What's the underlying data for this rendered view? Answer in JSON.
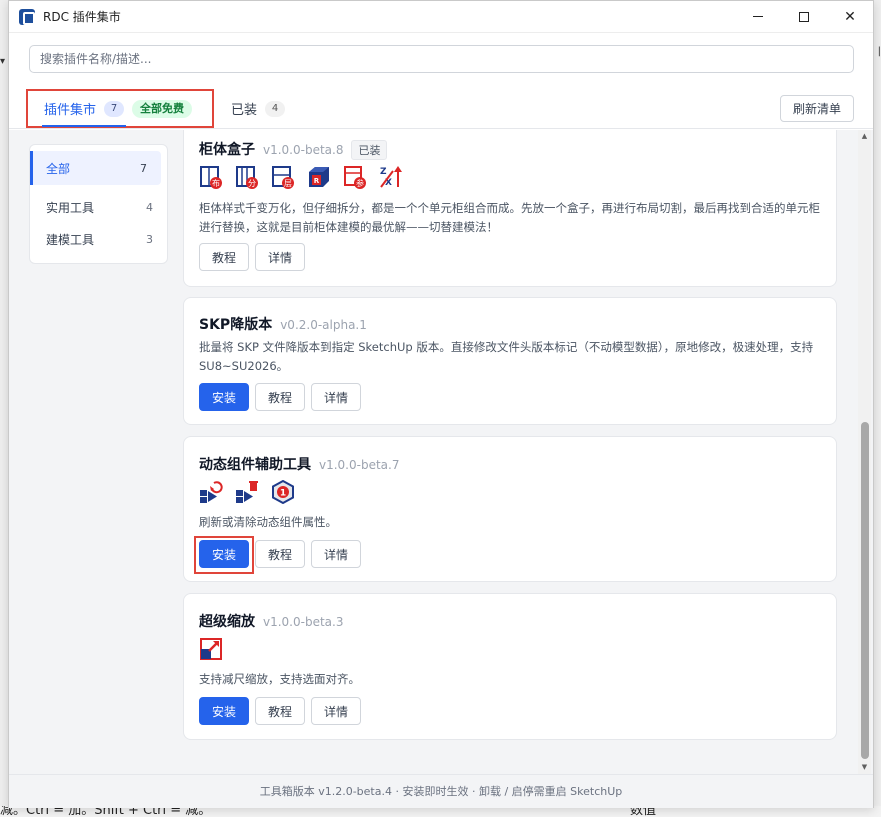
{
  "window": {
    "title": "RDC 插件集市",
    "minimize_glyph": "—",
    "maximize_glyph": "☐",
    "close_glyph": "✕"
  },
  "search": {
    "placeholder": "搜索插件名称/描述...",
    "value": ""
  },
  "tabs": [
    {
      "label": "插件集市",
      "count": "7",
      "badge": "全部免费",
      "active": true
    },
    {
      "label": "已装",
      "count": "4",
      "active": false
    }
  ],
  "refresh_label": "刷新清单",
  "sidebar": {
    "items": [
      {
        "label": "全部",
        "count": "7",
        "active": true
      },
      {
        "label": "实用工具",
        "count": "4",
        "active": false
      },
      {
        "label": "建模工具",
        "count": "3",
        "active": false
      }
    ]
  },
  "plugins": [
    {
      "name": "柜体盒子",
      "version": "v1.0.0-beta.8",
      "installed_badge": "已装",
      "description": "柜体样式千变万化，但仔细拆分，都是一个个单元柜组合而成。先放一个盒子，再进行布局切割，最后再找到合适的单元柜进行替换，这就是目前柜体建模的最优解——切替建模法！",
      "buttons": {
        "tutorial": "教程",
        "details": "详情"
      },
      "icons": [
        "cabinet-layout-icon",
        "cabinet-split-icon",
        "cabinet-shelf-icon",
        "cabinet-replace-icon",
        "cabinet-param-icon",
        "axis-swap-icon"
      ],
      "icon_glyphs": [
        "布",
        "分",
        "层",
        "R",
        "参"
      ]
    },
    {
      "name": "SKP降版本",
      "version": "v0.2.0-alpha.1",
      "description": "批量将 SKP 文件降版本到指定 SketchUp 版本。直接修改文件头版本标记（不动模型数据），原地修改，极速处理，支持 SU8~SU2026。",
      "buttons": {
        "install": "安装",
        "tutorial": "教程",
        "details": "详情"
      }
    },
    {
      "name": "动态组件辅助工具",
      "version": "v1.0.0-beta.7",
      "description": "刷新或清除动态组件属性。",
      "buttons": {
        "install": "安装",
        "tutorial": "教程",
        "details": "详情"
      },
      "icons": [
        "dc-refresh-icon",
        "dc-clear-icon",
        "dc-hexagon-icon"
      ],
      "icon_glyphs": [
        "1"
      ]
    },
    {
      "name": "超级缩放",
      "version": "v1.0.0-beta.3",
      "description": "支持减尺缩放，支持选面对齐。",
      "buttons": {
        "install": "安装",
        "tutorial": "教程",
        "details": "详情"
      },
      "icons": [
        "super-scale-icon"
      ]
    }
  ],
  "footer": "工具箱版本 v1.2.0-beta.4 · 安装即时生效 · 卸载 / 启停需重启 SketchUp",
  "background": {
    "hint_text": "减。Ctrl = 加。Shift + Ctrl = 减。",
    "right_text": "数值"
  },
  "colors": {
    "accent": "#2563eb",
    "highlight": "#e0453a",
    "free_badge_bg": "#dcfce7",
    "free_badge_fg": "#15803d",
    "icon_blue": "#1e3a8a",
    "icon_red": "#dc2626"
  }
}
